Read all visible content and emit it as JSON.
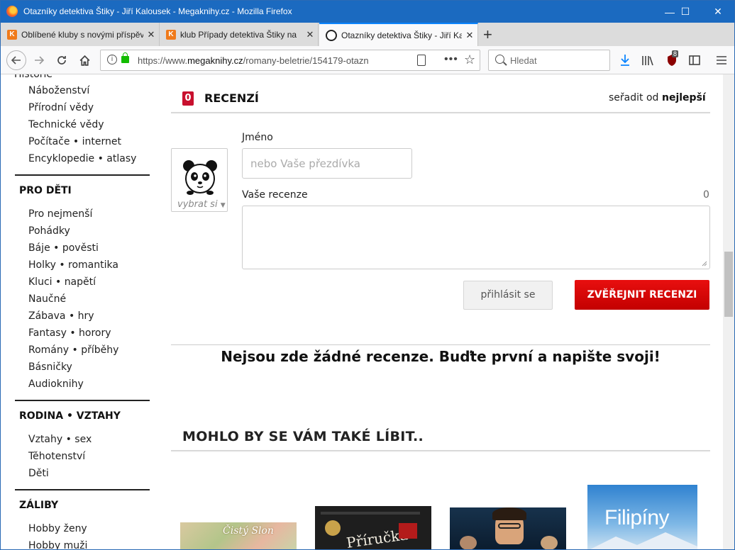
{
  "window": {
    "title": "Otazníky detektiva Štiky - Jiří Kalousek - Megaknihy.cz - Mozilla Firefox",
    "minimize": "—",
    "maximize": "☐",
    "close": "✕"
  },
  "tabs": [
    {
      "label": "Oblíbené kluby s novými příspěvky",
      "favicon": "megaknihy-icon"
    },
    {
      "label": "klub Případy detektiva Štiky na",
      "favicon": "megaknihy-icon"
    },
    {
      "label": "Otazníky detektiva Štiky - Jiří Ka",
      "favicon": "panda-icon",
      "active": true
    }
  ],
  "navbar": {
    "url_prefix": "https://www.",
    "url_domain": "megaknihy.cz",
    "url_path": "/romany-beletrie/154179-otazn",
    "search_placeholder": "Hledat",
    "badge": "8"
  },
  "sidebar": {
    "top_items": [
      "Historie",
      "Náboženství",
      "Přírodní vědy",
      "Technické vědy",
      "Počítače • internet",
      "Encyklopedie • atlasy"
    ],
    "sections": [
      {
        "title": "PRO DĚTI",
        "items": [
          "Pro nejmenší",
          "Pohádky",
          "Báje • pověsti",
          "Holky • romantika",
          "Kluci • napětí",
          "Naučné",
          "Zábava • hry",
          "Fantasy • horory",
          "Romány • příběhy",
          "Básničky",
          "Audioknihy"
        ]
      },
      {
        "title": "RODINA • VZTAHY",
        "items": [
          "Vztahy • sex",
          "Těhotenství",
          "Děti"
        ]
      },
      {
        "title": "ZÁLIBY",
        "items": [
          "Hobby ženy",
          "Hobby muži"
        ]
      }
    ]
  },
  "reviews": {
    "count": "0",
    "title": "RECENZÍ",
    "sort_label": "seřadit od",
    "sort_value": "nejlepší",
    "avatar_label": "vybrat si",
    "name_label": "Jméno",
    "name_placeholder": "nebo Vaše přezdívka",
    "review_label": "Vaše recenze",
    "char_count": "0",
    "login_button": "přihlásit se",
    "publish_button": "ZVĚŘEJNIT RECENZI",
    "empty_message": "Nejsou zde žádné recenze. Buďte první a napište svoji!"
  },
  "recommendations": {
    "title": "MOHLO BY SE VÁM TAKÉ LÍBIT..",
    "books": [
      {
        "cover_text": "Čistý Slon"
      },
      {
        "cover_text": "Příručka"
      },
      {
        "cover_text": ""
      },
      {
        "cover_text": "Filipíny"
      }
    ]
  },
  "colors": {
    "accent_red": "#c8102e",
    "titlebar_blue": "#1b6ac0"
  }
}
